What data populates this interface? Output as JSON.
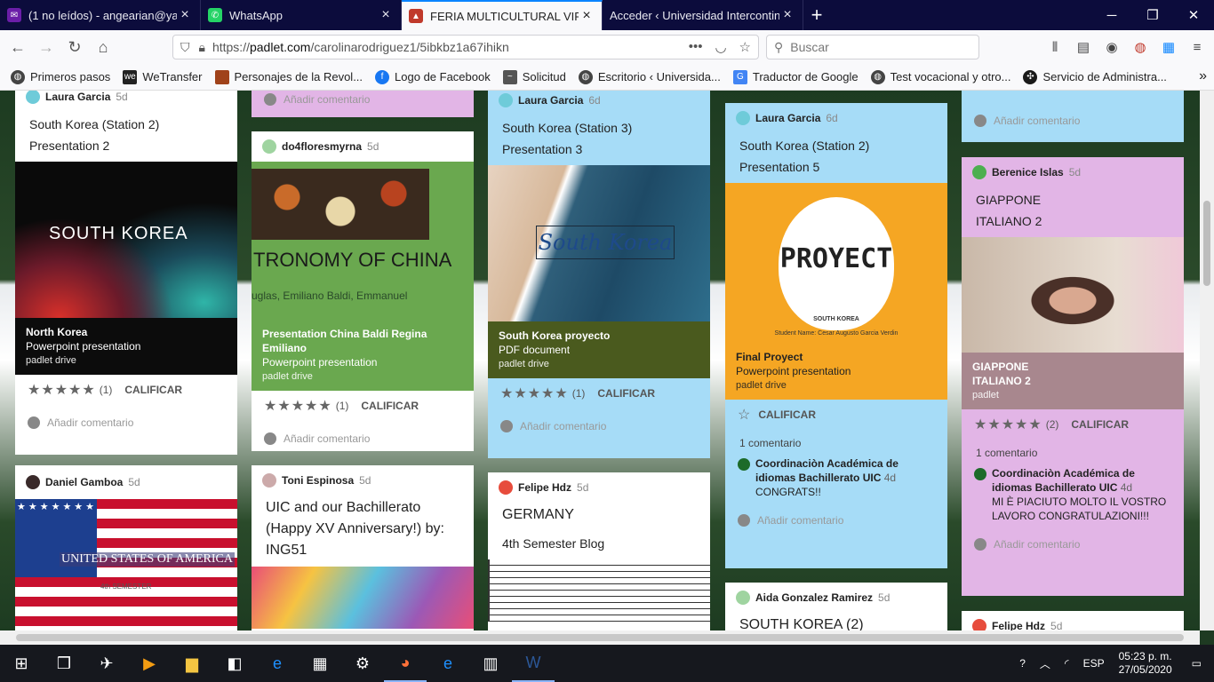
{
  "tabs": [
    {
      "title": "(1 no leídos) - angearian@yaho",
      "fav_color": "#6b1ea8"
    },
    {
      "title": "WhatsApp",
      "fav_color": "#25d366"
    },
    {
      "title": "FERIA MULTICULTURAL VIRTUA",
      "fav_color": "#c0392b",
      "active": true
    },
    {
      "title": "Acceder ‹ Universidad Intercontinen",
      "fav_color": "#2a2a5a"
    }
  ],
  "address": {
    "prefix": "https://",
    "domain": "padlet.com",
    "path": "/carolinarodriguez1/5ibkbz1a67ihikn"
  },
  "search_placeholder": "Buscar",
  "bookmarks": [
    "Primeros pasos",
    "WeTransfer",
    "Personajes de la Revol...",
    "Logo de Facebook",
    "Solicitud",
    "Escritorio ‹ Universida...",
    "Traductor de Google",
    "Test vocacional y otro...",
    "Servicio de Administra..."
  ],
  "add_comment": "Añadir comentario",
  "rate_label": "CALIFICAR",
  "cards": {
    "c1": {
      "author": "Laura Garcia",
      "age": "5d",
      "title1": "South Korea (Station 2)",
      "title2": "Presentation 2",
      "slide_title": "SOUTH KOREA",
      "att_title": "North Korea",
      "att_type": "Powerpoint presentation",
      "att_src": "padlet drive",
      "count": "(1)"
    },
    "c2": {
      "author": "do4floresmyrna",
      "age": "5d",
      "slide_title": "TRONOMY OF CHINA",
      "slide_sub": "uglas, Emiliano Baldi, Emmanuel",
      "att_title": "Presentation China Baldi Regina Emiliano",
      "att_type": "Powerpoint presentation",
      "att_src": "padlet drive",
      "count": "(1)"
    },
    "c3": {
      "author": "Laura Garcia",
      "age": "6d",
      "title1": "South Korea (Station 3)",
      "title2": "Presentation 3",
      "slide_title": "South Korea",
      "att_title": "South Korea proyecto",
      "att_type": "PDF document",
      "att_src": "padlet drive",
      "count": "(1)"
    },
    "c4": {
      "author": "Laura Garcia",
      "age": "6d",
      "title1": "South Korea (Station 2)",
      "title2": "Presentation 5",
      "slide_title": "PROYECT",
      "slide_sub": "SOUTH KOREA",
      "slide_student": "Student Name: Cesar Augusto Garcia Verdin",
      "att_title": "Final Proyect",
      "att_type": "Powerpoint presentation",
      "att_src": "padlet drive",
      "comment_count": "1 comentario",
      "cm_author": "Coordinaciòn Académica de idiomas Bachillerato UIC",
      "cm_age": "4d",
      "cm_text": "CONGRATS!!"
    },
    "c5": {
      "author": "Berenice Islas",
      "age": "5d",
      "title1": "GIAPPONE",
      "title2": "ITALIANO 2",
      "att_title": "GIAPPONE",
      "att_type": "ITALIANO 2",
      "att_src": "padlet",
      "count": "(2)",
      "comment_count": "1 comentario",
      "cm_author": "Coordinaciòn Académica de idiomas Bachillerato UIC",
      "cm_age": "4d",
      "cm_text": "MI È PIACIUTO MOLTO IL VOSTRO LAVORO CONGRATULAZIONI!!!"
    },
    "c6": {
      "author": "Daniel Gamboa",
      "age": "5d",
      "flag_text": "UNITED STATES OF AMERICA",
      "flag_sub": "4th SEMESTER"
    },
    "c7": {
      "author": "Toni Espinosa",
      "age": "5d",
      "title1": "UIC and our Bachillerato (Happy XV Anniversary!) by: ING51"
    },
    "c8": {
      "author": "Felipe Hdz",
      "age": "5d",
      "title1": "GERMANY",
      "title2": "4th Semester  Blog"
    },
    "c9": {
      "author": "Aida Gonzalez Ramirez",
      "age": "5d",
      "title1": "SOUTH KOREA (2)"
    },
    "c10": {
      "author": "Felipe Hdz",
      "age": "5d"
    }
  },
  "taskbar": {
    "lang": "ESP",
    "time": "05:23 p. m.",
    "date": "27/05/2020"
  }
}
